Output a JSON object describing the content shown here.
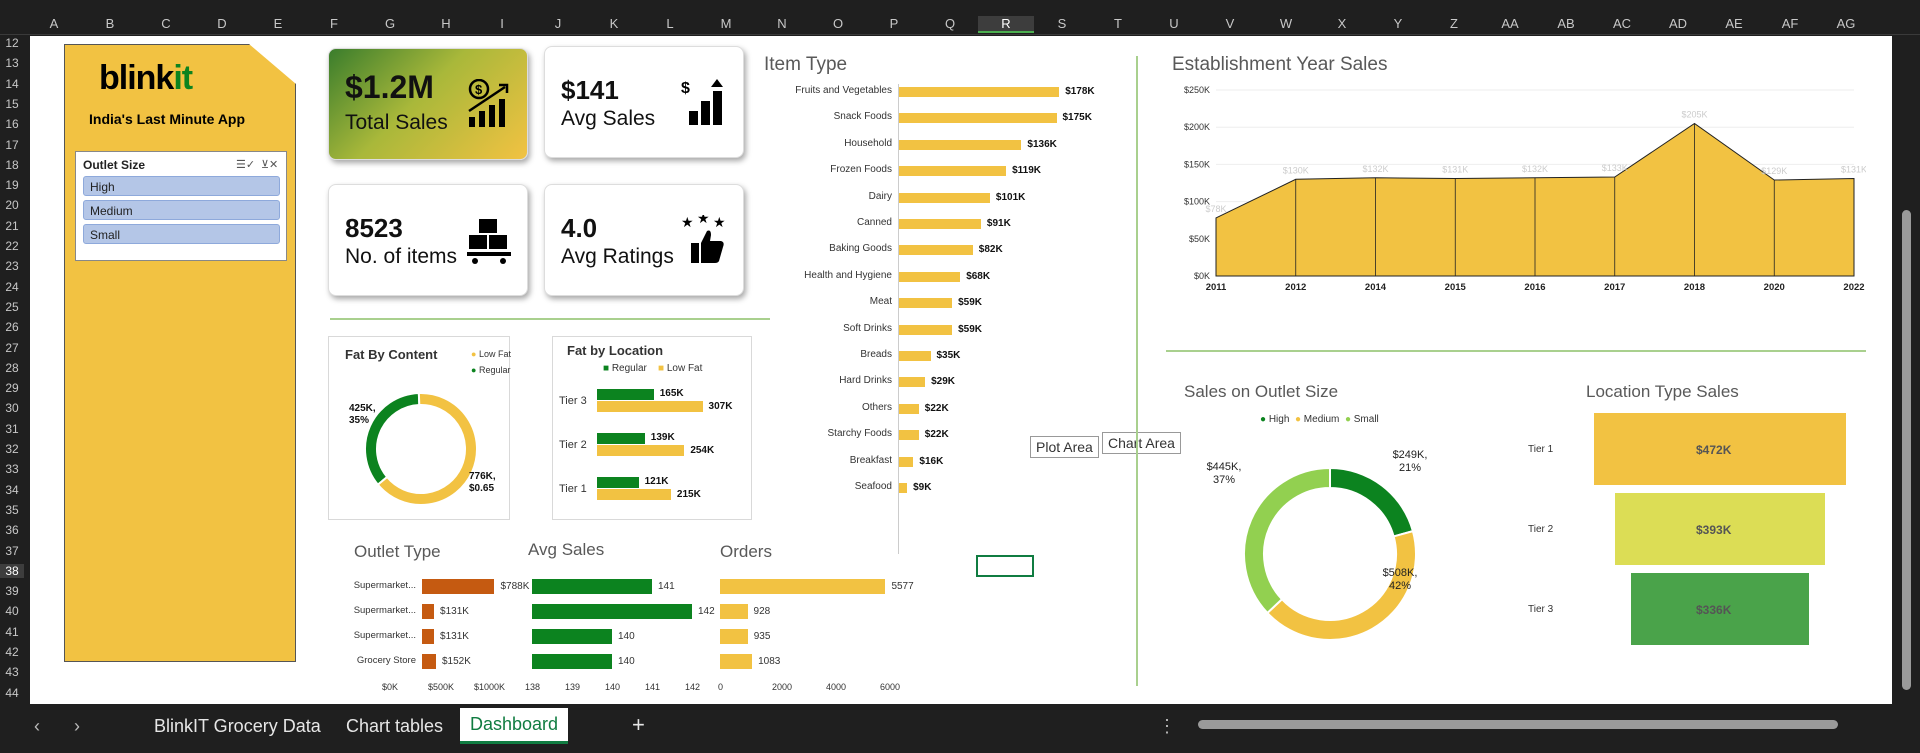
{
  "col_headers": [
    "A",
    "B",
    "C",
    "D",
    "E",
    "F",
    "G",
    "H",
    "I",
    "J",
    "K",
    "L",
    "M",
    "N",
    "O",
    "P",
    "Q",
    "R",
    "S",
    "T",
    "U",
    "V",
    "W",
    "X",
    "Y",
    "Z",
    "AA",
    "AB",
    "AC",
    "AD",
    "AE",
    "AF",
    "AG"
  ],
  "selected_col": "R",
  "row_headers": [
    "12",
    "13",
    "14",
    "15",
    "16",
    "17",
    "18",
    "19",
    "20",
    "21",
    "22",
    "23",
    "24",
    "25",
    "26",
    "27",
    "28",
    "29",
    "30",
    "31",
    "32",
    "33",
    "34",
    "35",
    "36",
    "37",
    "38",
    "39",
    "40",
    "41",
    "42",
    "43",
    "44"
  ],
  "selected_row": "38",
  "brand": {
    "name_a": "blink",
    "name_b": "it",
    "tagline": "India's Last Minute App"
  },
  "slicer": {
    "title": "Outlet Size",
    "items": [
      "High",
      "Medium",
      "Small"
    ]
  },
  "kpis": {
    "total_sales": {
      "value": "$1.2M",
      "label": "Total Sales"
    },
    "avg_sales": {
      "value": "$141",
      "label": "Avg Sales"
    },
    "items": {
      "value": "8523",
      "label": "No. of items"
    },
    "avg_ratings": {
      "value": "4.0",
      "label": "Avg Ratings"
    }
  },
  "charts": {
    "fat_content": {
      "title": "Fat By Content",
      "legend": [
        "Low Fat",
        "Regular"
      ],
      "label_regular": "425K,\n35%",
      "label_lowfat": "776K,\n$0.65"
    },
    "fat_location": {
      "title": "Fat by Location",
      "legend": [
        "Regular",
        "Low Fat"
      ]
    },
    "item_type": {
      "title": "Item Type"
    },
    "establishment": {
      "title": "Establishment Year Sales"
    },
    "outlet_size": {
      "title": "Sales on Outlet Size",
      "legend": [
        "High",
        "Medium",
        "Small"
      ]
    },
    "location_type": {
      "title": "Location Type Sales"
    },
    "outlet_type": {
      "title": "Outlet Type"
    },
    "avg_sales": {
      "title": "Avg Sales"
    },
    "orders": {
      "title": "Orders"
    }
  },
  "tooltips": {
    "plot_area": "Plot Area",
    "chart_area": "Chart Area"
  },
  "tabs": [
    "BlinkIT Grocery Data",
    "Chart tables",
    "Dashboard"
  ],
  "active_tab": "Dashboard",
  "colors": {
    "yellow": "#f2c242",
    "green": "#0c831f",
    "lightgreen": "#92d050",
    "orange": "#c55a11"
  },
  "chart_data": [
    {
      "type": "bar",
      "name": "item_type",
      "categories": [
        "Fruits and Vegetables",
        "Snack Foods",
        "Household",
        "Frozen Foods",
        "Dairy",
        "Canned",
        "Baking Goods",
        "Health and Hygiene",
        "Meat",
        "Soft Drinks",
        "Breads",
        "Hard Drinks",
        "Others",
        "Starchy Foods",
        "Breakfast",
        "Seafood"
      ],
      "values": [
        178,
        175,
        136,
        119,
        101,
        91,
        82,
        68,
        59,
        59,
        35,
        29,
        22,
        22,
        16,
        9
      ],
      "labels": [
        "$178K",
        "$175K",
        "$136K",
        "$119K",
        "$101K",
        "$91K",
        "$82K",
        "$68K",
        "$59K",
        "$59K",
        "$35K",
        "$29K",
        "$22K",
        "$22K",
        "$16K",
        "$9K"
      ]
    },
    {
      "type": "bar",
      "name": "fat_location",
      "categories": [
        "Tier 3",
        "Tier 2",
        "Tier 1"
      ],
      "series": [
        {
          "name": "Regular",
          "values": [
            165,
            139,
            121
          ],
          "labels": [
            "165K",
            "139K",
            "121K"
          ]
        },
        {
          "name": "Low Fat",
          "values": [
            307,
            254,
            215
          ],
          "labels": [
            "307K",
            "254K",
            "215K"
          ]
        }
      ]
    },
    {
      "type": "pie",
      "name": "fat_content",
      "categories": [
        "Regular",
        "Low Fat"
      ],
      "values": [
        425,
        776
      ]
    },
    {
      "type": "area",
      "name": "establishment",
      "x": [
        "2011",
        "2012",
        "2014",
        "2015",
        "2016",
        "2017",
        "2018",
        "2020",
        "2022"
      ],
      "values": [
        78,
        130,
        132,
        131,
        132,
        133,
        205,
        129,
        131
      ],
      "labels": [
        "$78K",
        "$130K",
        "$132K",
        "$131K",
        "$132K",
        "$133K",
        "$205K",
        "$129K",
        "$131K"
      ],
      "y_ticks": [
        "$250K",
        "$200K",
        "$150K",
        "$100K",
        "$50K",
        "$0K"
      ],
      "ylim": [
        0,
        250
      ]
    },
    {
      "type": "pie",
      "name": "outlet_size",
      "categories": [
        "High",
        "Medium",
        "Small"
      ],
      "values": [
        249,
        508,
        445
      ],
      "labels": [
        "$249K,\n21%",
        "$508K,\n42%",
        "$445K,\n37%"
      ]
    },
    {
      "type": "bar",
      "name": "location_type",
      "categories": [
        "Tier 1",
        "Tier 2",
        "Tier 3"
      ],
      "values": [
        472,
        393,
        336
      ],
      "labels": [
        "$472K",
        "$393K",
        "$336K"
      ]
    },
    {
      "type": "bar",
      "name": "outlet_type",
      "categories": [
        "Supermarket...",
        "Supermarket...",
        "Supermarket...",
        "Grocery Store"
      ],
      "values": [
        788,
        131,
        131,
        152
      ],
      "labels": [
        "$788K",
        "$131K",
        "$131K",
        "$152K"
      ],
      "x_ticks": [
        "$0K",
        "$500K",
        "$1000K"
      ],
      "xlim": [
        0,
        1000
      ]
    },
    {
      "type": "bar",
      "name": "avg_sales",
      "values": [
        141,
        142,
        140,
        140
      ],
      "labels": [
        "141",
        "142",
        "140",
        "140"
      ],
      "x_ticks": [
        "138",
        "139",
        "140",
        "141",
        "142"
      ],
      "xlim": [
        138,
        142
      ]
    },
    {
      "type": "bar",
      "name": "orders",
      "values": [
        5577,
        928,
        935,
        1083
      ],
      "labels": [
        "5577",
        "928",
        "935",
        "1083"
      ],
      "x_ticks": [
        "0",
        "2000",
        "4000",
        "6000"
      ],
      "xlim": [
        0,
        6000
      ]
    }
  ]
}
